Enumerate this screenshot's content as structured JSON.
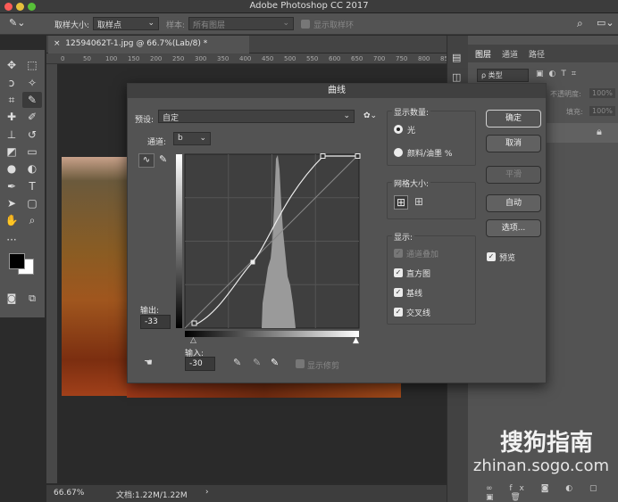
{
  "app": {
    "title": "Adobe Photoshop CC 2017"
  },
  "options_bar": {
    "sample_size_label": "取样大小:",
    "sample_size_value": "取样点",
    "sample_label": "样本:",
    "sample_value": "所有图层",
    "show_ring_label": "显示取样环"
  },
  "document": {
    "tab_label": "12594062T-1.jpg @ 66.7%(Lab/8) *",
    "zoom": "66.67%",
    "doc_info": "文档:1.22M/1.22M"
  },
  "ruler": {
    "ticks": [
      "0",
      "50",
      "100",
      "150",
      "200",
      "250",
      "300",
      "350",
      "400",
      "450",
      "500",
      "550",
      "600",
      "650",
      "700",
      "750",
      "800",
      "850"
    ]
  },
  "layers_panel": {
    "tabs": [
      "图层",
      "通道",
      "路径"
    ],
    "kind_label": "ρ 类型",
    "opacity_label": "不透明度:",
    "opacity_value": "100%",
    "fill_label": "填充:",
    "fill_value": "100%"
  },
  "curves": {
    "title": "曲线",
    "preset_label": "预设:",
    "preset_value": "自定",
    "channel_label": "通道:",
    "channel_value": "b",
    "output_label": "输出:",
    "output_value": "-33",
    "input_label": "输入:",
    "input_value": "-30",
    "show_clipping_label": "显示修剪",
    "display_amount": {
      "title": "显示数量:",
      "options": [
        "光",
        "颜料/油墨 %"
      ],
      "selected": 0
    },
    "grid_size": {
      "title": "网格大小:"
    },
    "show": {
      "title": "显示:",
      "options": [
        {
          "label": "通道叠加",
          "checked": true,
          "disabled": true
        },
        {
          "label": "直方图",
          "checked": true
        },
        {
          "label": "基线",
          "checked": true
        },
        {
          "label": "交叉线",
          "checked": true
        }
      ]
    },
    "buttons": {
      "ok": "确定",
      "cancel": "取消",
      "smooth": "平滑",
      "auto": "自动",
      "options": "选项..."
    },
    "preview_label": "预览"
  },
  "watermark": {
    "brand": "搜狗指南",
    "url": "zhinan.sogo.com"
  }
}
